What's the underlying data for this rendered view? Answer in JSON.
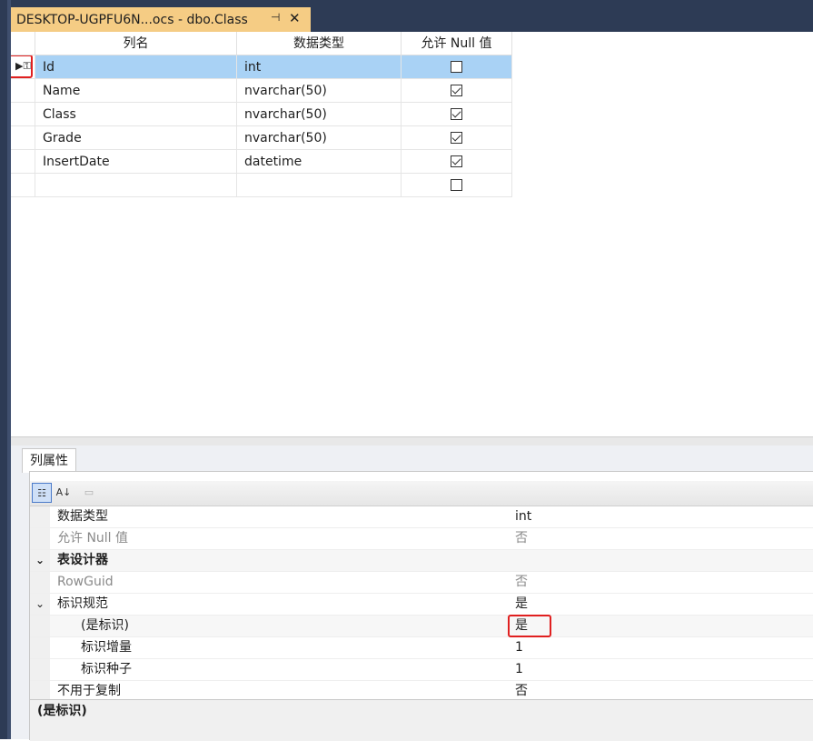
{
  "tab": {
    "title": "DESKTOP-UGPFU6N...ocs - dbo.Class",
    "pin_glyph": "⊣",
    "close_glyph": "✕"
  },
  "grid": {
    "headers": [
      "列名",
      "数据类型",
      "允许 Null 值"
    ],
    "rows": [
      {
        "name": "Id",
        "type": "int",
        "nullable": false
      },
      {
        "name": "Name",
        "type": "nvarchar(50)",
        "nullable": true
      },
      {
        "name": "Class",
        "type": "nvarchar(50)",
        "nullable": true
      },
      {
        "name": "Grade",
        "type": "nvarchar(50)",
        "nullable": true
      },
      {
        "name": "InsertDate",
        "type": "datetime",
        "nullable": true
      },
      {
        "name": "",
        "type": "",
        "nullable": false
      }
    ]
  },
  "properties": {
    "tab_label": "列属性",
    "rows": [
      {
        "name": "数据类型",
        "value": "int"
      },
      {
        "name": "允许 Null 值",
        "value": "否"
      },
      {
        "name": "表设计器",
        "value": ""
      },
      {
        "name": "RowGuid",
        "value": "否"
      },
      {
        "name": "标识规范",
        "value": "是"
      },
      {
        "name": "(是标识)",
        "value": "是"
      },
      {
        "name": "标识增量",
        "value": "1"
      },
      {
        "name": "标识种子",
        "value": "1"
      },
      {
        "name": "不用于复制",
        "value": "否"
      }
    ],
    "description_title": "(是标识)"
  },
  "colors": {
    "tab_active": "#f5cc84",
    "selected_row": "#a9d2f5",
    "frame": "#2d3b55",
    "highlight": "#e02020"
  }
}
